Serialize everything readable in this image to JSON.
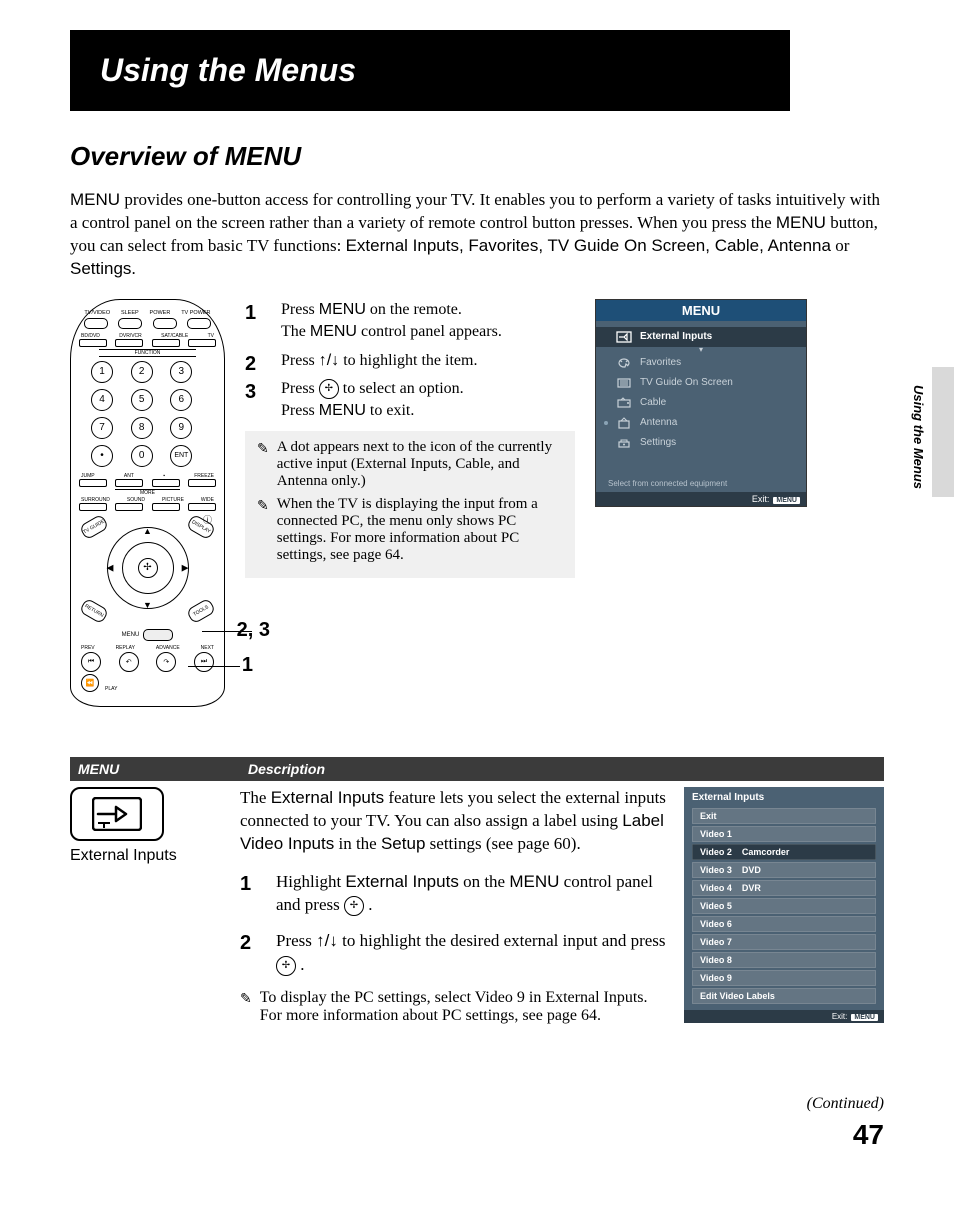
{
  "banner": "Using the Menus",
  "section_title": "Overview of MENU",
  "intro_menu_word": "MENU",
  "intro_part1": " provides one-button access for controlling your TV. It enables you to perform a variety of tasks intuitively with a control panel on the screen rather than a variety of remote control button presses. When you press the ",
  "intro_menu_word2": "MENU",
  "intro_part2": " button, you can select from basic TV functions: ",
  "intro_funcs": "External Inputs, Favorites, TV Guide On Screen, Cable, Antenna",
  "intro_or": " or ",
  "intro_settings": "Settings",
  "intro_period": ".",
  "remote": {
    "top_labels": [
      "TV/VIDEO",
      "SLEEP",
      "POWER",
      "TV POWER"
    ],
    "thin_labels": [
      "BD/DVD",
      "DVR/VCR",
      "SAT/CABLE",
      "TV"
    ],
    "function": "FUNCTION",
    "row_labels_1": [
      "JUMP",
      "ANT",
      "",
      "FREEZE"
    ],
    "more": "MORE",
    "row_labels_2": [
      "SURROUND",
      "SOUND",
      "PICTURE",
      "WIDE"
    ],
    "tvguide": "TV GUIDE",
    "display": "DISPLAY",
    "return": "RETURN",
    "tools": "TOOLS",
    "menu": "MENU",
    "trans": [
      "PREV",
      "REPLAY",
      "ADVANCE",
      "NEXT"
    ],
    "play": "PLAY",
    "ent": "ENT"
  },
  "callouts": {
    "a": "2, 3",
    "b": "1"
  },
  "steps": [
    {
      "pre": "Press ",
      "b1": "MENU",
      "mid": " on the remote.",
      "line2_pre": "The ",
      "line2_b": "MENU",
      "line2_post": " control panel appears."
    },
    {
      "pre": "Press ",
      "arrows": "♠/♣",
      "post": " to highlight the item."
    },
    {
      "pre": "Press ",
      "icon": "enter",
      "mid": " to select an option.",
      "line2_pre": "Press ",
      "line2_b": "MENU",
      "line2_post": " to exit."
    }
  ],
  "arrow_glyphs": "↑/↓",
  "notes": {
    "n1": "A dot appears next to the icon of the currently active input (External Inputs, Cable, and Antenna only.)",
    "n2": "When the TV is displaying the input from a connected PC, the menu only shows PC settings. For more information about PC settings, see page 64."
  },
  "tv": {
    "title": "MENU",
    "items": [
      {
        "label": "External Inputs",
        "dot": false,
        "selected": true
      },
      {
        "label": "Favorites",
        "dot": false
      },
      {
        "label": "TV Guide On Screen",
        "dot": false
      },
      {
        "label": "Cable",
        "dot": false
      },
      {
        "label": "Antenna",
        "dot": true
      },
      {
        "label": "Settings",
        "dot": false
      }
    ],
    "hint": "Select from connected equipment",
    "exit": "Exit:",
    "exit_badge": "MENU"
  },
  "side_label": "Using the Menus",
  "table": {
    "head_menu": "MENU",
    "head_desc": "Description",
    "left_label": "External Inputs",
    "desc_pre": "The ",
    "desc_b1": "External Inputs",
    "desc_mid1": " feature lets you select the external inputs connected to your TV. You can also assign a label using ",
    "desc_b2": "Label Video Inputs",
    "desc_mid2": " in the ",
    "desc_b3": "Setup",
    "desc_mid3": " settings (see page 60).",
    "step1_pre": "Highlight ",
    "step1_b": "External Inputs",
    "step1_mid": " on the ",
    "step1_b2": "MENU",
    "step1_post": " control panel and press ",
    "step1_end": " .",
    "step2_pre": "Press ",
    "step2_arrows": "↑/↓",
    "step2_mid": " to highlight the desired external input and press ",
    "step2_end": " .",
    "note": "To display the PC settings, select Video 9 in External Inputs. For more information about PC settings, see page 64."
  },
  "ext_screen": {
    "title": "External Inputs",
    "rows": [
      {
        "a": "Exit"
      },
      {
        "a": "Video 1"
      },
      {
        "a": "Video 2",
        "b": "Camcorder",
        "sel": true
      },
      {
        "a": "Video 3",
        "b": "DVD"
      },
      {
        "a": "Video 4",
        "b": "DVR"
      },
      {
        "a": "Video 5"
      },
      {
        "a": "Video 6"
      },
      {
        "a": "Video 7"
      },
      {
        "a": "Video 8"
      },
      {
        "a": "Video 9"
      },
      {
        "a": "Edit Video Labels"
      }
    ],
    "exit": "Exit:",
    "exit_badge": "MENU"
  },
  "continued": "(Continued)",
  "page": "47"
}
